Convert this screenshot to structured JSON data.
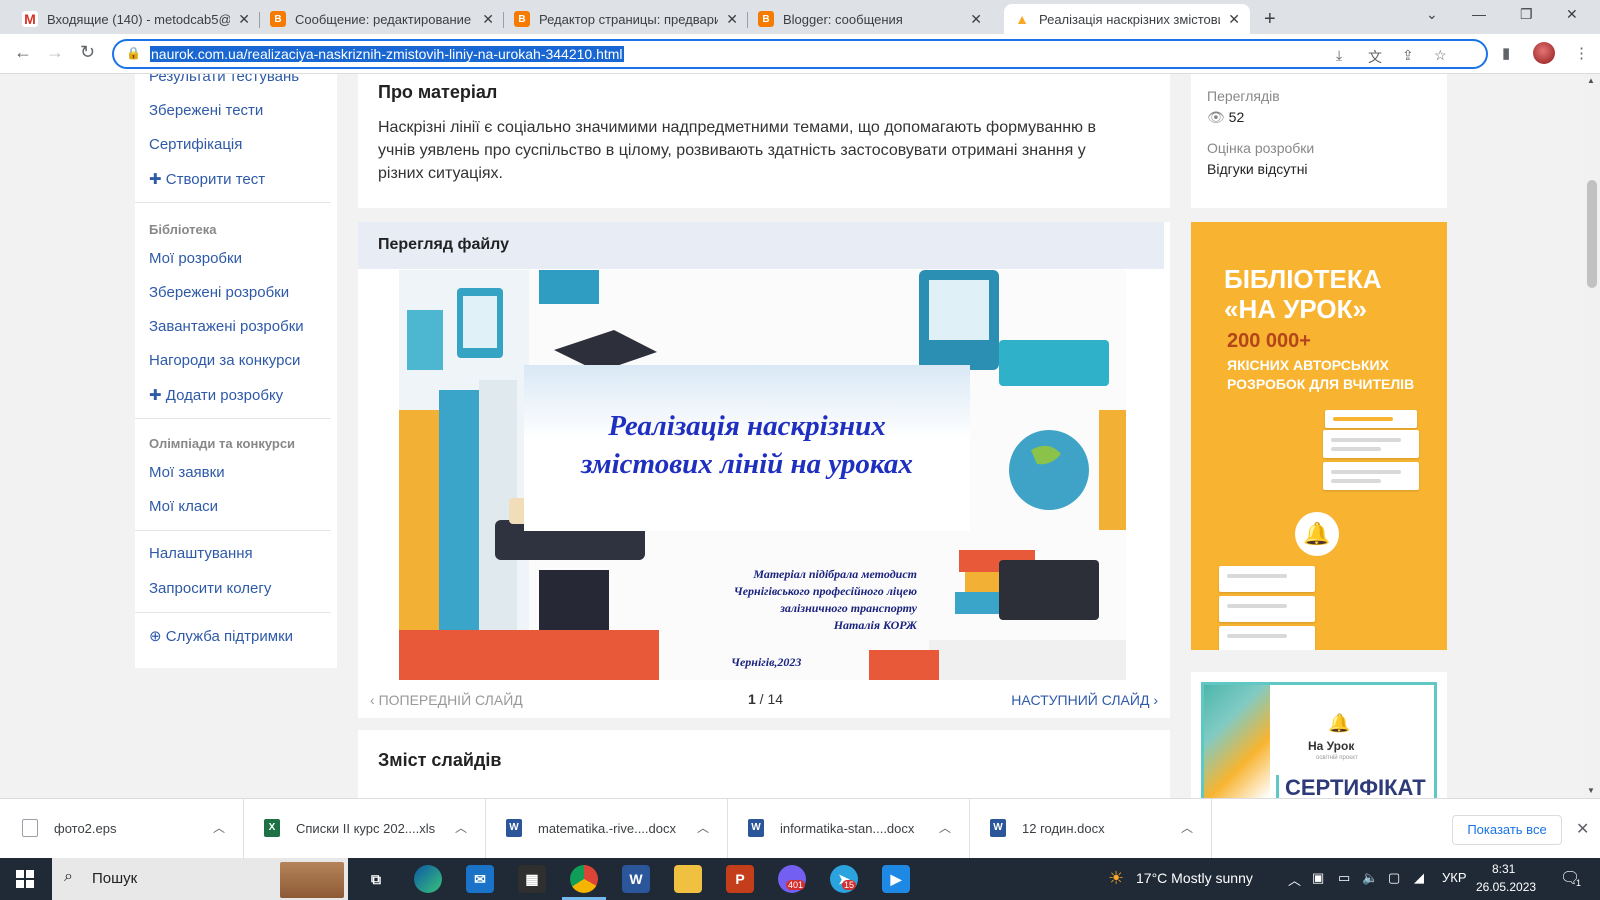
{
  "browser": {
    "tabs": [
      {
        "title": "Входящие (140) - metodcab5@g",
        "icon": "gmail-icon"
      },
      {
        "title": "Сообщение: редактирование",
        "icon": "blogger-icon"
      },
      {
        "title": "Редактор страницы: предварит",
        "icon": "blogger-icon"
      },
      {
        "title": "Blogger: сообщения",
        "icon": "blogger-icon"
      },
      {
        "title": "Реалізація наскрізних змістови",
        "icon": "naurok-bell-icon"
      }
    ],
    "url": "naurok.com.ua/realizaciya-naskriznih-zmistovih-liniy-na-urokah-344210.html"
  },
  "sidebar": {
    "tests_items": [
      "Результати тестувань",
      "Збережені тести",
      "Сертифікація",
      "Створити тест"
    ],
    "library_heading": "Бібліотека",
    "library_items": [
      "Мої розробки",
      "Збережені розробки",
      "Завантажені розробки",
      "Нагороди за конкурси",
      "Додати розробку"
    ],
    "olymp_heading": "Олімпіади та конкурси",
    "olymp_items": [
      "Мої заявки",
      "Мої класи"
    ],
    "settings": "Налаштування",
    "invite": "Запросити колегу",
    "support": "Служба підтримки"
  },
  "about": {
    "title": "Про матеріал",
    "text": "Наскрізні лінії є соціально значимими надпредметними темами, що допомагають формуванню в учнів уявлень про суспільство в цілому, розвивають здатність застосовувати отримані знання у різних ситуаціях."
  },
  "preview": {
    "title": "Перегляд файлу",
    "slide_title_line1": "Реалізація наскрізних",
    "slide_title_line2": "змістових ліній на уроках",
    "slide_credit": [
      "Матеріал підібрала методист",
      "Чернігівського професійного ліцею",
      "залізничного транспорту",
      "Наталія КОРЖ"
    ],
    "slide_city": "Чернігів,2023",
    "prev_label": "ПОПЕРЕДНІЙ СЛАЙД",
    "next_label": "НАСТУПНИЙ СЛАЙД",
    "current": "1",
    "total": "14"
  },
  "contents_title": "Зміст слайдів",
  "stats": {
    "views_label": "Переглядів",
    "views": "52",
    "rating_label": "Оцінка розробки",
    "rating_value": "Відгуки відсутні"
  },
  "ad": {
    "line1": "БІБЛІОТЕКА",
    "line2": "«НА УРОК»",
    "count": "200 000+",
    "desc1": "ЯКІСНИХ АВТОРСЬКИХ",
    "desc2": "РОЗРОБОК ДЛЯ ВЧИТЕЛІВ"
  },
  "certificate": {
    "brand": "На Урок",
    "subtitle": "освітній проєкт",
    "title": "СЕРТИФІКАТ"
  },
  "downloads": [
    {
      "name": "фото2.eps",
      "icon": "file-icon",
      "color": "#ffffff"
    },
    {
      "name": "Списки ІІ курс 202....xls",
      "icon": "excel-icon",
      "color": "#1e7145"
    },
    {
      "name": "matematika.-rive....docx",
      "icon": "word-icon",
      "color": "#2b579a"
    },
    {
      "name": "informatika-stan....docx",
      "icon": "word-icon",
      "color": "#2b579a"
    },
    {
      "name": "12 годин.docx",
      "icon": "word-icon",
      "color": "#2b579a"
    }
  ],
  "downloads_show_all": "Показать все",
  "taskbar": {
    "search_placeholder": "Пошук",
    "weather": "17°C  Mostly sunny",
    "lang": "УКР",
    "time": "8:31",
    "date": "26.05.2023",
    "badge_viber": "401",
    "badge_telegram": "15",
    "notifications": "1"
  },
  "colors": {
    "accent": "#1a73e8",
    "link": "#2f5aa8",
    "ad_bg": "#f8b430",
    "preview_header": "#e8ecf5",
    "slide_title": "#1f2fbf"
  }
}
